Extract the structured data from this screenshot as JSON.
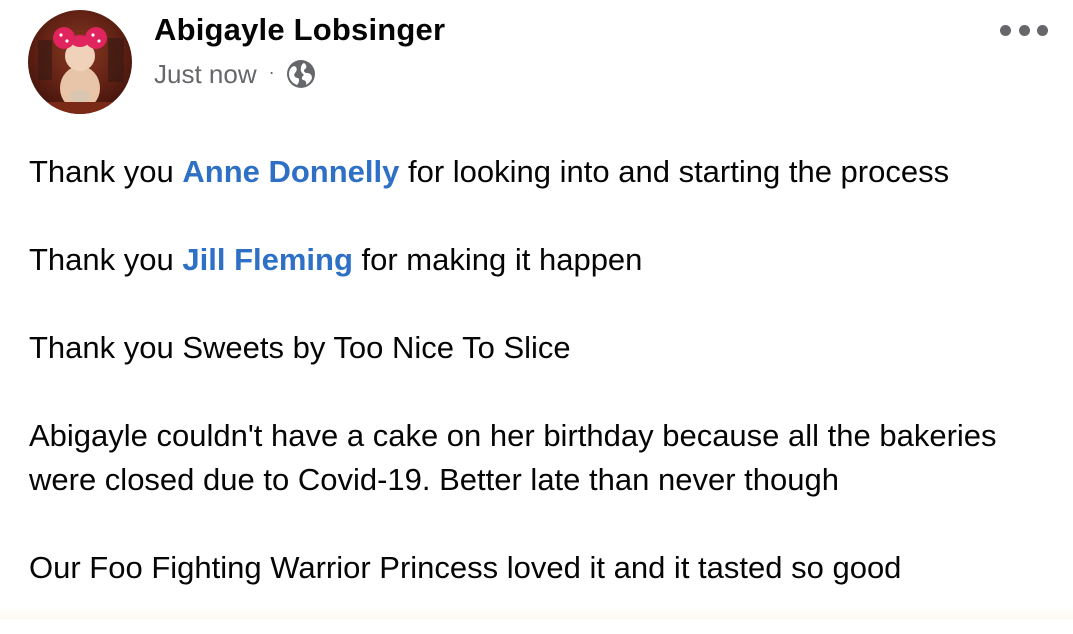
{
  "post": {
    "author": "Abigayle Lobsinger",
    "timestamp": "Just now",
    "separator": "·",
    "privacy_icon": "globe-icon",
    "more_icon": "more-options-icon",
    "paragraphs": [
      {
        "pre": "Thank you ",
        "mention": "Anne Donnelly",
        "post": " for looking into and starting the process"
      },
      {
        "pre": "Thank you ",
        "mention": "Jill Fleming",
        "post": " for making it happen"
      },
      {
        "text": "Thank you Sweets by Too Nice To Slice"
      },
      {
        "text": "Abigayle couldn't have a cake on her birthday because all the bakeries were closed due to Covid-19. Better late than never though"
      },
      {
        "text": "Our Foo Fighting Warrior Princess loved it and it tasted so good"
      }
    ]
  },
  "colors": {
    "mention": "#2d70c6",
    "meta": "#65676b",
    "text": "#050505"
  }
}
